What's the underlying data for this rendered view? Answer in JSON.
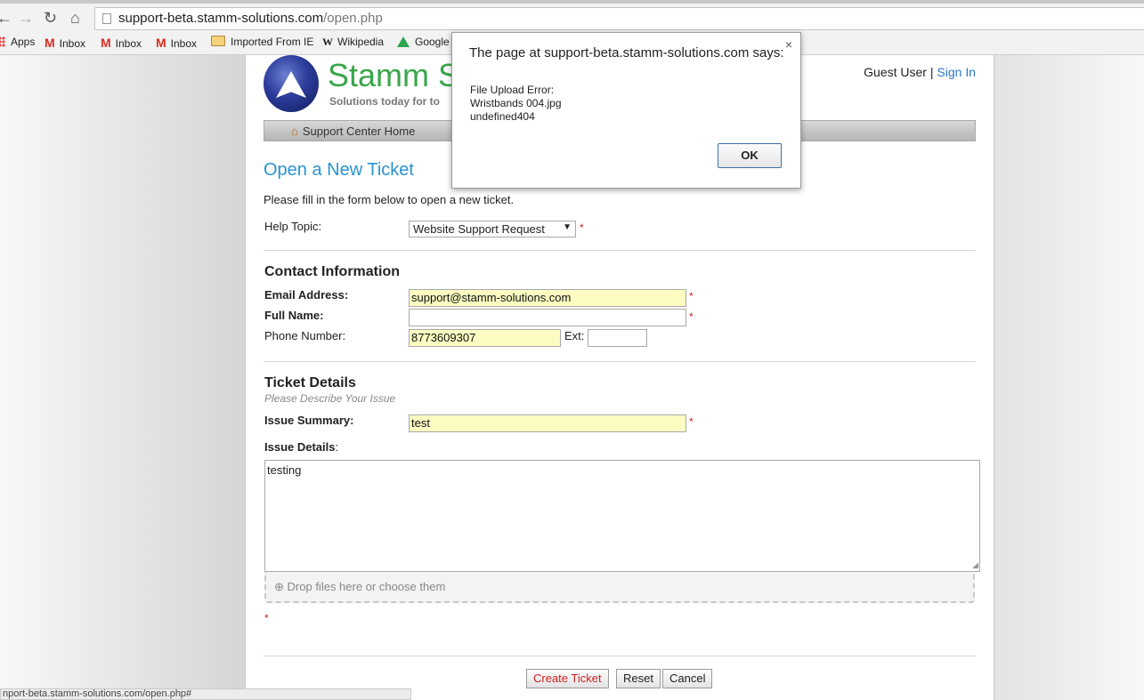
{
  "browser": {
    "url_host": "support-beta.stamm-solutions.com",
    "url_path": "/open.php",
    "bookmarks": [
      "Apps",
      "Inbox",
      "Inbox",
      "Inbox",
      "Imported From IE",
      "Wikipedia",
      "Google"
    ],
    "status_url": "nport-beta.stamm-solutions.com/open.php#"
  },
  "header": {
    "brand": "Stamm Sc",
    "tagline": "Solutions today for to",
    "guest_user": "Guest User",
    "separator": "|",
    "sign_in": "Sign In",
    "nav_home": "Support Center Home"
  },
  "form": {
    "title": "Open a New Ticket",
    "intro": "Please fill in the form below to open a new ticket.",
    "help_topic_label": "Help Topic:",
    "help_topic_value": "Website Support Request",
    "required_mark": "*",
    "contact_heading": "Contact Information",
    "email_label": "Email Address:",
    "email_value": "support@stamm-solutions.com",
    "fullname_label": "Full Name:",
    "fullname_value": "",
    "phone_label": "Phone Number:",
    "phone_value": "8773609307",
    "ext_label": "Ext:",
    "ext_value": "",
    "details_heading": "Ticket Details",
    "details_sub": "Please Describe Your Issue",
    "summary_label": "Issue Summary:",
    "summary_value": "test",
    "issue_details_label": "Issue Details",
    "issue_details_colon": ":",
    "issue_details_value": "testing",
    "dropzone_text": "Drop files here or choose them",
    "buttons": {
      "create": "Create Ticket",
      "reset": "Reset",
      "cancel": "Cancel"
    }
  },
  "dialog": {
    "title": "The page at support-beta.stamm-solutions.com says:",
    "close": "×",
    "lines": [
      "File Upload Error:",
      "Wristbands 004.jpg",
      "undefined404"
    ],
    "ok": "OK"
  },
  "colors": {
    "accent": "#2a93cf",
    "brand": "#3aa64a",
    "required": "#d02020",
    "autofill": "#fbfbc2"
  }
}
